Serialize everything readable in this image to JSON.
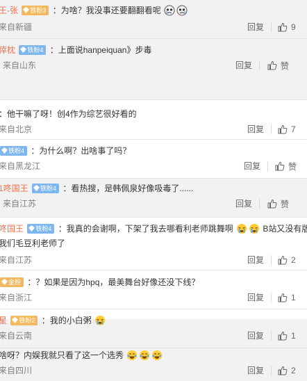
{
  "comments": [
    {
      "name": "王-张",
      "badge": "铁粉3",
      "text": "：为啥？我没事还要翻翻看呢",
      "emoji": [
        "crying-face",
        "crying-face"
      ],
      "location": "来自新疆",
      "reply": "回复",
      "likes": "9"
    },
    {
      "name": "倖枕",
      "badge": "铁粉4",
      "text": "：上面说hanpeiquan》步毒",
      "location": "来自山东",
      "reply": "回复",
      "likes": "赞"
    },
    {
      "text": "：他干嘛了呀！创4作为综艺很好看的",
      "location": "来自北京",
      "reply": "回复",
      "likes": "7"
    },
    {
      "badge": "铁粉4",
      "text": "：为什么啊？出啥事了吗？",
      "location": "来自黑龙江",
      "reply": "回复",
      "likes": "赞"
    },
    {
      "name": "1咚国王",
      "badge": "铁粉4",
      "text": "：看热搜，是韩佩泉好像吸毒了......",
      "location": "来自江苏",
      "reply": "回复",
      "likes": "赞"
    },
    {
      "name": "咚国王",
      "badge": "铁粉4",
      "text": "：我真的会谢啊，下架了我去哪看利老师跳舞啊",
      "emoji": [
        "sob-face",
        "sob-face"
      ],
      "text_tail": "B站又没有版",
      "text_line2": "我们毛豆利老师了",
      "location": "来自江苏",
      "reply": "回复",
      "likes": "2"
    },
    {
      "badge": "金粉",
      "text": "：？如果是因为hpq，最美舞台好像还没下线？",
      "location": "来自浙江",
      "reply": "回复",
      "likes": "1"
    },
    {
      "name": "星",
      "badge": "铁粉2",
      "text": "：我的小白粥",
      "emoji": [
        "sob-face"
      ],
      "location": "来自云南",
      "reply": "回复",
      "likes": "1"
    },
    {
      "text": "​啥呀？内娱我就只看了这一个选秀",
      "emoji": [
        "laughing-face",
        "laughing-face",
        "laughing-face"
      ],
      "location": "来自四川",
      "reply": "回复",
      "likes": "2"
    }
  ],
  "colors": {
    "name": "#eb7350",
    "badge_blue": "#7eb6f0",
    "badge_gold": "#f3b95f",
    "reply_block_bg": "#f2f2f2",
    "meta": "#808080"
  }
}
